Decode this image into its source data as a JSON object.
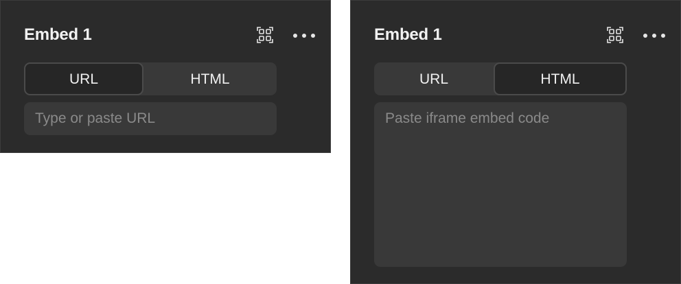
{
  "panels": [
    {
      "title": "Embed 1",
      "tabs": {
        "url_label": "URL",
        "html_label": "HTML"
      },
      "active_tab": "URL",
      "input_placeholder": "Type or paste URL",
      "input_value": ""
    },
    {
      "title": "Embed 1",
      "tabs": {
        "url_label": "URL",
        "html_label": "HTML"
      },
      "active_tab": "HTML",
      "input_placeholder": "Paste iframe embed code",
      "input_value": ""
    }
  ],
  "icons": {
    "focus": "focus-frame-icon",
    "more": "more-horizontal-icon"
  },
  "colors": {
    "panel_bg": "#2b2b2b",
    "control_bg": "#393939",
    "active_tab_bg": "#262626",
    "text": "#f0f0f0",
    "placeholder": "#8a8a8a"
  }
}
